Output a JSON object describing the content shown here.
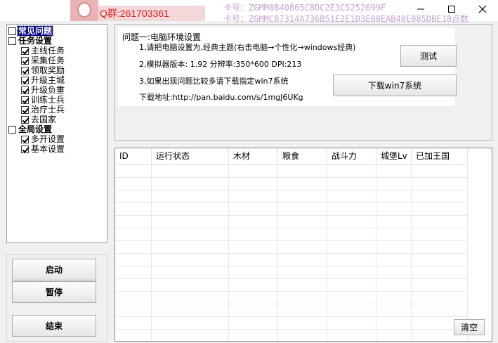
{
  "titlebar": {
    "qgroup": "Q群:261703361",
    "card_line_1": "卡号：ZGMM0B40865C8DC2E3C5252699F",
    "card_line_2": "卡号：ZGMMC87314A736B51E2E1D3E88EAB40E085DBE18点数"
  },
  "tree": {
    "items": [
      {
        "label": "常见问题",
        "checked": false,
        "bold": true,
        "selected": true
      },
      {
        "label": "任务设置",
        "checked": false,
        "bold": true
      },
      {
        "label": "主线任务",
        "checked": true
      },
      {
        "label": "采集任务",
        "checked": true
      },
      {
        "label": "领取奖励",
        "checked": true
      },
      {
        "label": "升级主城",
        "checked": true
      },
      {
        "label": "升级负重",
        "checked": true
      },
      {
        "label": "训练士兵",
        "checked": true
      },
      {
        "label": "治疗士兵",
        "checked": true
      },
      {
        "label": "去国家",
        "checked": true
      },
      {
        "label": "全局设置",
        "checked": false,
        "bold": true
      },
      {
        "label": "多开设置",
        "checked": true
      },
      {
        "label": "基本设置",
        "checked": true
      }
    ]
  },
  "buttons": {
    "start": "启动",
    "pause": "暂停",
    "end": "结束",
    "test": "测试",
    "download": "下载win7系统",
    "clear": "清空"
  },
  "info": {
    "title": "问题一:电脑环境设置",
    "line1": "1,请把电脑设置为,经典主题(右击电脑→个性化→windows经典)",
    "line2": "2,模拟器版本: 1.92 分辨率:350*600 DPI:213",
    "line3": "3,如果出现问题比较多请下载指定win7系统",
    "line4": "下载地址:http://pan.baidu.com/s/1mgJ6UKg"
  },
  "table": {
    "columns": [
      "ID",
      "运行状态",
      "木材",
      "粮食",
      "战斗力",
      "城堡Lv",
      "已加王国"
    ],
    "rows": []
  }
}
